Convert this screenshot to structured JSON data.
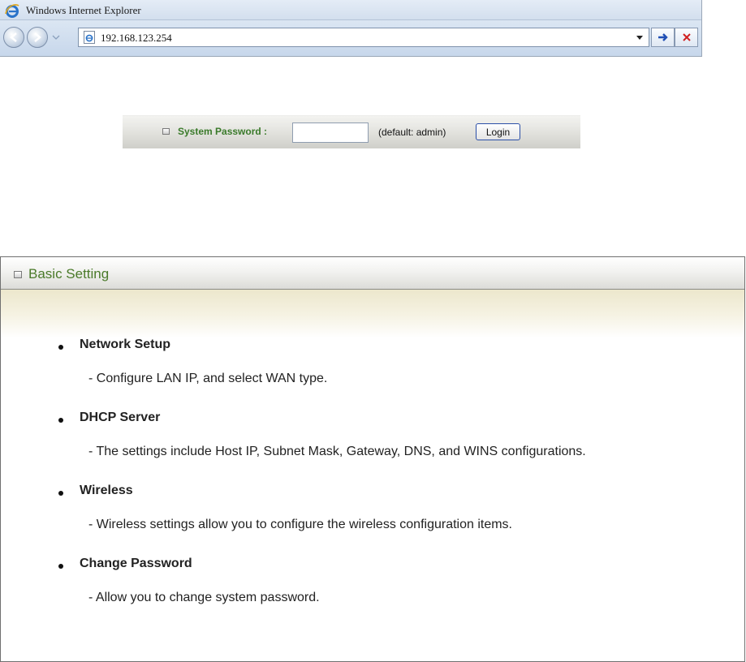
{
  "browser": {
    "title": "Windows Internet Explorer",
    "address": "192.168.123.254",
    "icons": [
      "ie-logo-icon",
      "back-arrow-icon",
      "forward-arrow-icon",
      "chevron-down-icon",
      "page-icon",
      "go-arrow-icon",
      "close-icon"
    ]
  },
  "login": {
    "label": "System Password :",
    "password_value": "",
    "hint": "(default: admin)",
    "button": "Login"
  },
  "panel": {
    "title": "Basic Setting",
    "items": [
      {
        "title": "Network Setup",
        "desc": "- Configure LAN IP, and select WAN type."
      },
      {
        "title": "DHCP Server",
        "desc": "- The settings include Host IP, Subnet Mask, Gateway, DNS, and WINS configurations."
      },
      {
        "title": "Wireless",
        "desc": "- Wireless settings allow you to configure the wireless configuration items."
      },
      {
        "title": "Change Password",
        "desc": "- Allow you to change system password."
      }
    ]
  },
  "colors": {
    "label_green": "#3a7a2a",
    "panel_title_green": "#4a7a2a",
    "login_button_border": "#2b4fa8",
    "stop_red": "#d02020",
    "go_blue": "#1f4fb5"
  }
}
